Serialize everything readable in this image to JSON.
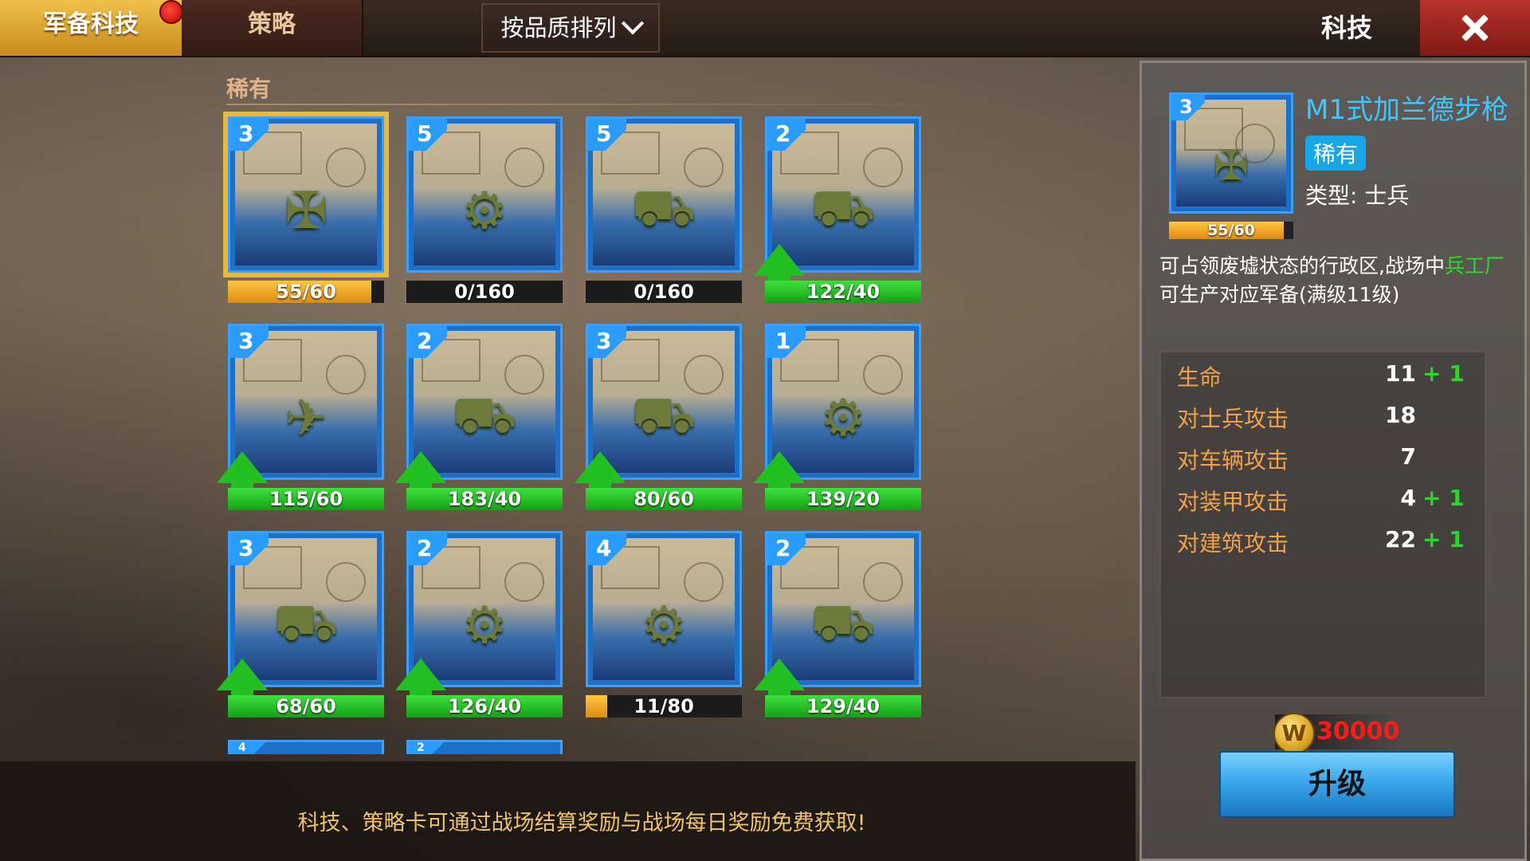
{
  "tabs": {
    "armory": "军备科技",
    "strategy": "策略"
  },
  "sort": {
    "label": "按品质排列"
  },
  "header": {
    "title": "科技"
  },
  "section": {
    "label": "稀有"
  },
  "cards": [
    {
      "level": "3",
      "progress": "55/60",
      "unit": "rifle",
      "fill": 0.92,
      "fill_color": "orange",
      "upgradable": false,
      "selected": true
    },
    {
      "level": "5",
      "progress": "0/160",
      "unit": "anti-tank-gun",
      "fill": 0,
      "fill_color": "orange",
      "upgradable": false,
      "selected": false
    },
    {
      "level": "5",
      "progress": "0/160",
      "unit": "jeep",
      "fill": 0,
      "fill_color": "orange",
      "upgradable": false,
      "selected": false
    },
    {
      "level": "2",
      "progress": "122/40",
      "unit": "light-tank",
      "fill": 1,
      "fill_color": "green",
      "upgradable": true,
      "selected": false
    },
    {
      "level": "3",
      "progress": "115/60",
      "unit": "recon-plane",
      "fill": 1,
      "fill_color": "green",
      "upgradable": true,
      "selected": false
    },
    {
      "level": "2",
      "progress": "183/40",
      "unit": "armored-car",
      "fill": 1,
      "fill_color": "green",
      "upgradable": true,
      "selected": false
    },
    {
      "level": "3",
      "progress": "80/60",
      "unit": "self-propelled-gun",
      "fill": 1,
      "fill_color": "green",
      "upgradable": true,
      "selected": false
    },
    {
      "level": "1",
      "progress": "139/20",
      "unit": "motorcycle",
      "fill": 1,
      "fill_color": "green",
      "upgradable": true,
      "selected": false
    },
    {
      "level": "3",
      "progress": "68/60",
      "unit": "medium-tank",
      "fill": 1,
      "fill_color": "green",
      "upgradable": true,
      "selected": false
    },
    {
      "level": "2",
      "progress": "126/40",
      "unit": "anti-air-gun",
      "fill": 1,
      "fill_color": "green",
      "upgradable": true,
      "selected": false
    },
    {
      "level": "4",
      "progress": "11/80",
      "unit": "howitzer",
      "fill": 0.14,
      "fill_color": "orange",
      "upgradable": false,
      "selected": false
    },
    {
      "level": "2",
      "progress": "129/40",
      "unit": "tank-destroyer",
      "fill": 1,
      "fill_color": "green",
      "upgradable": true,
      "selected": false
    }
  ],
  "partial_cards": [
    {
      "level": "4"
    },
    {
      "level": "2"
    }
  ],
  "tip": "科技、策略卡可通过战场结算奖励与战场每日奖励免费获取!",
  "detail": {
    "level": "3",
    "name": "M1式加兰德步枪",
    "rarity": "稀有",
    "type": "类型: 士兵",
    "progress": "55/60",
    "progress_fill": 0.92,
    "desc_part1": "可占领废墟状态的行政区,战场中",
    "desc_highlight": "兵工厂",
    "desc_part2": "可生产对应军备(满级11级)",
    "stats": [
      {
        "label": "生命",
        "value": "11",
        "bonus": "+ 1"
      },
      {
        "label": "对士兵攻击",
        "value": "18",
        "bonus": ""
      },
      {
        "label": "对车辆攻击",
        "value": "7",
        "bonus": ""
      },
      {
        "label": "对装甲攻击",
        "value": "4",
        "bonus": "+ 1"
      },
      {
        "label": "对建筑攻击",
        "value": "22",
        "bonus": "+ 1"
      }
    ],
    "cost": "30000",
    "coin_symbol": "W",
    "upgrade_label": "升级"
  },
  "colors": {
    "accent_gold": "#e8b840",
    "card_blue": "#1f6fc8",
    "green_bar": "#22c022",
    "orange_bar": "#f0a020",
    "cost_red": "#ff1a1a"
  }
}
